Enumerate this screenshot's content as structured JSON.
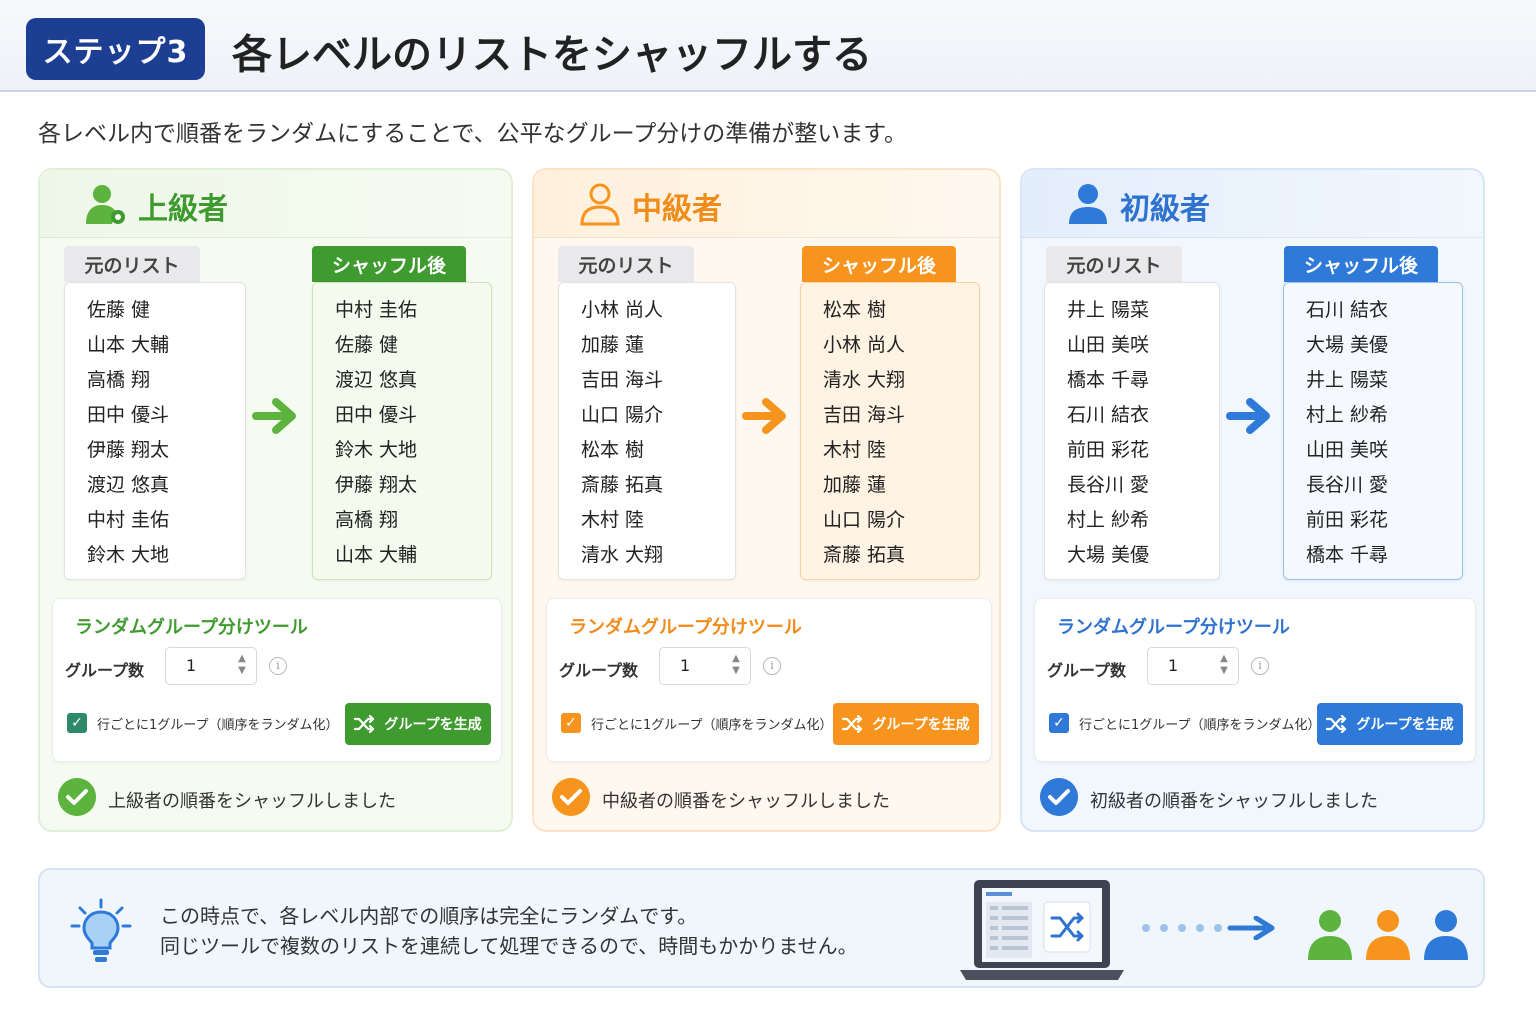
{
  "header": {
    "step": "ステップ3",
    "title": "各レベルのリストをシャッフルする"
  },
  "subtitle": "各レベル内で順番をランダムにすることで、公平なグループ分けの準備が整います。",
  "levels": [
    {
      "name": "上級者",
      "color": "#3f9a2f",
      "original_label": "元のリスト",
      "shuffled_label": "シャッフル後",
      "original": [
        "佐藤 健",
        "山本 大輔",
        "高橋 翔",
        "田中 優斗",
        "伊藤 翔太",
        "渡辺 悠真",
        "中村 圭佑",
        "鈴木 大地"
      ],
      "shuffled": [
        "中村 圭佑",
        "佐藤 健",
        "渡辺 悠真",
        "田中 優斗",
        "鈴木 大地",
        "伊藤 翔太",
        "高橋 翔",
        "山本 大輔"
      ],
      "tool_title": "ランダムグループ分けツール",
      "group_count_label": "グループ数",
      "group_count": "1",
      "checkbox_label": "行ごとに1グループ（順序をランダム化）",
      "checkbox_checked": true,
      "button_label": "グループを生成",
      "status": "上級者の順番をシャッフルしました"
    },
    {
      "name": "中級者",
      "color": "#f7941d",
      "original_label": "元のリスト",
      "shuffled_label": "シャッフル後",
      "original": [
        "小林 尚人",
        "加藤 蓮",
        "吉田 海斗",
        "山口 陽介",
        "松本 樹",
        "斎藤 拓真",
        "木村 陸",
        "清水 大翔"
      ],
      "shuffled": [
        "松本 樹",
        "小林 尚人",
        "清水 大翔",
        "吉田 海斗",
        "木村 陸",
        "加藤 蓮",
        "山口 陽介",
        "斎藤 拓真"
      ],
      "tool_title": "ランダムグループ分けツール",
      "group_count_label": "グループ数",
      "group_count": "1",
      "checkbox_label": "行ごとに1グループ（順序をランダム化）",
      "checkbox_checked": true,
      "button_label": "グループを生成",
      "status": "中級者の順番をシャッフルしました"
    },
    {
      "name": "初級者",
      "color": "#2f7ad9",
      "original_label": "元のリスト",
      "shuffled_label": "シャッフル後",
      "original": [
        "井上 陽菜",
        "山田 美咲",
        "橋本 千尋",
        "石川 結衣",
        "前田 彩花",
        "長谷川 愛",
        "村上 紗希",
        "大場 美優"
      ],
      "shuffled": [
        "石川 結衣",
        "大場 美優",
        "井上 陽菜",
        "村上 紗希",
        "山田 美咲",
        "長谷川 愛",
        "前田 彩花",
        "橋本 千尋"
      ],
      "tool_title": "ランダムグループ分けツール",
      "group_count_label": "グループ数",
      "group_count": "1",
      "checkbox_label": "行ごとに1グループ（順序をランダム化）",
      "checkbox_checked": true,
      "button_label": "グループを生成",
      "status": "初級者の順番をシャッフルしました"
    }
  ],
  "note": {
    "line1": "この時点で、各レベル内部での順序は完全にランダムです。",
    "line2": "同じツールで複数のリストを連続して処理できるので、時間もかかりません。",
    "icons": [
      "lightbulb-icon",
      "laptop-icon",
      "shuffle-icon",
      "arrow-right-icon",
      "person-icon"
    ],
    "people_colors": [
      "#5cb33e",
      "#f7941d",
      "#2f7ad9"
    ]
  }
}
